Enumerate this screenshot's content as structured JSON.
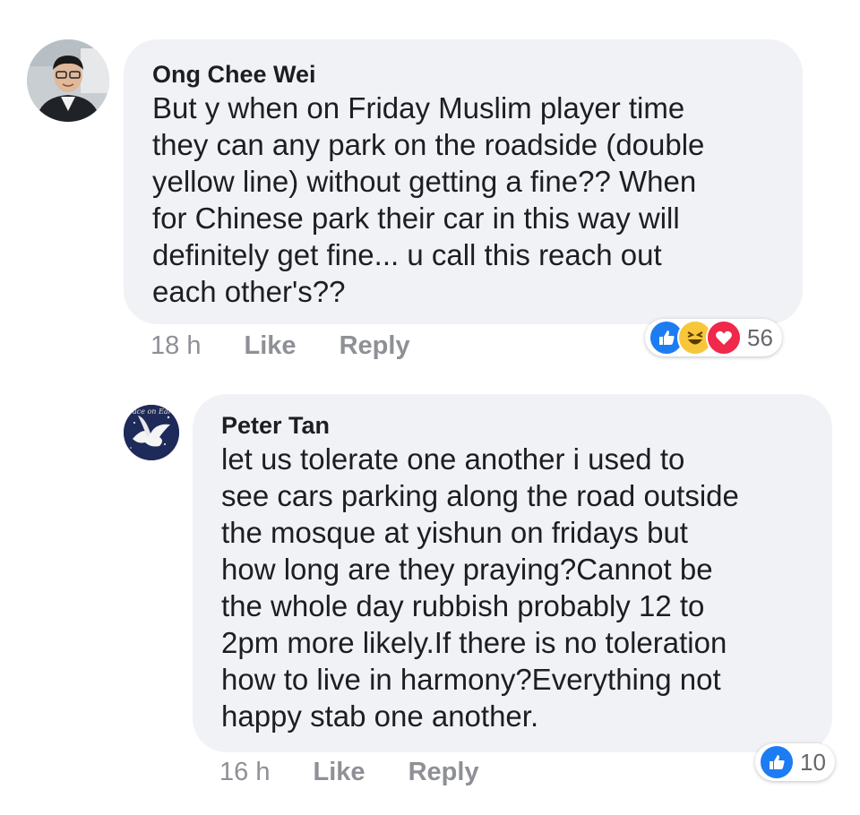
{
  "comments": [
    {
      "author": "Ong Chee Wei",
      "text": "But y when on Friday Muslim player time\nthey can any park on the roadside (double\nyellow line) without getting a fine?? When\nfor Chinese park their car in this way will\ndefinitely get fine... u call this reach out\neach other's??",
      "time": "18 h",
      "like_label": "Like",
      "reply_label": "Reply",
      "reactions": [
        "like-icon",
        "haha-icon",
        "love-icon"
      ],
      "reaction_count": "56"
    },
    {
      "author": "Peter Tan",
      "avatar_text": "Peace on Earth",
      "text": "let us tolerate one another i used to\nsee cars parking along the road outside\nthe mosque at yishun on fridays but\nhow long are they praying?Cannot be\nthe whole day rubbish probably 12 to\n2pm more likely.If there is no toleration\nhow to live in harmony?Everything not\nhappy stab one another.",
      "time": "16 h",
      "like_label": "Like",
      "reply_label": "Reply",
      "reactions": [
        "like-icon"
      ],
      "reaction_count": "10"
    }
  ],
  "colors": {
    "bubble": "#f1f2f6",
    "meta": "#8e9096",
    "like": "#1d7cf2",
    "haha": "#f7c63b",
    "love": "#f0284a"
  }
}
